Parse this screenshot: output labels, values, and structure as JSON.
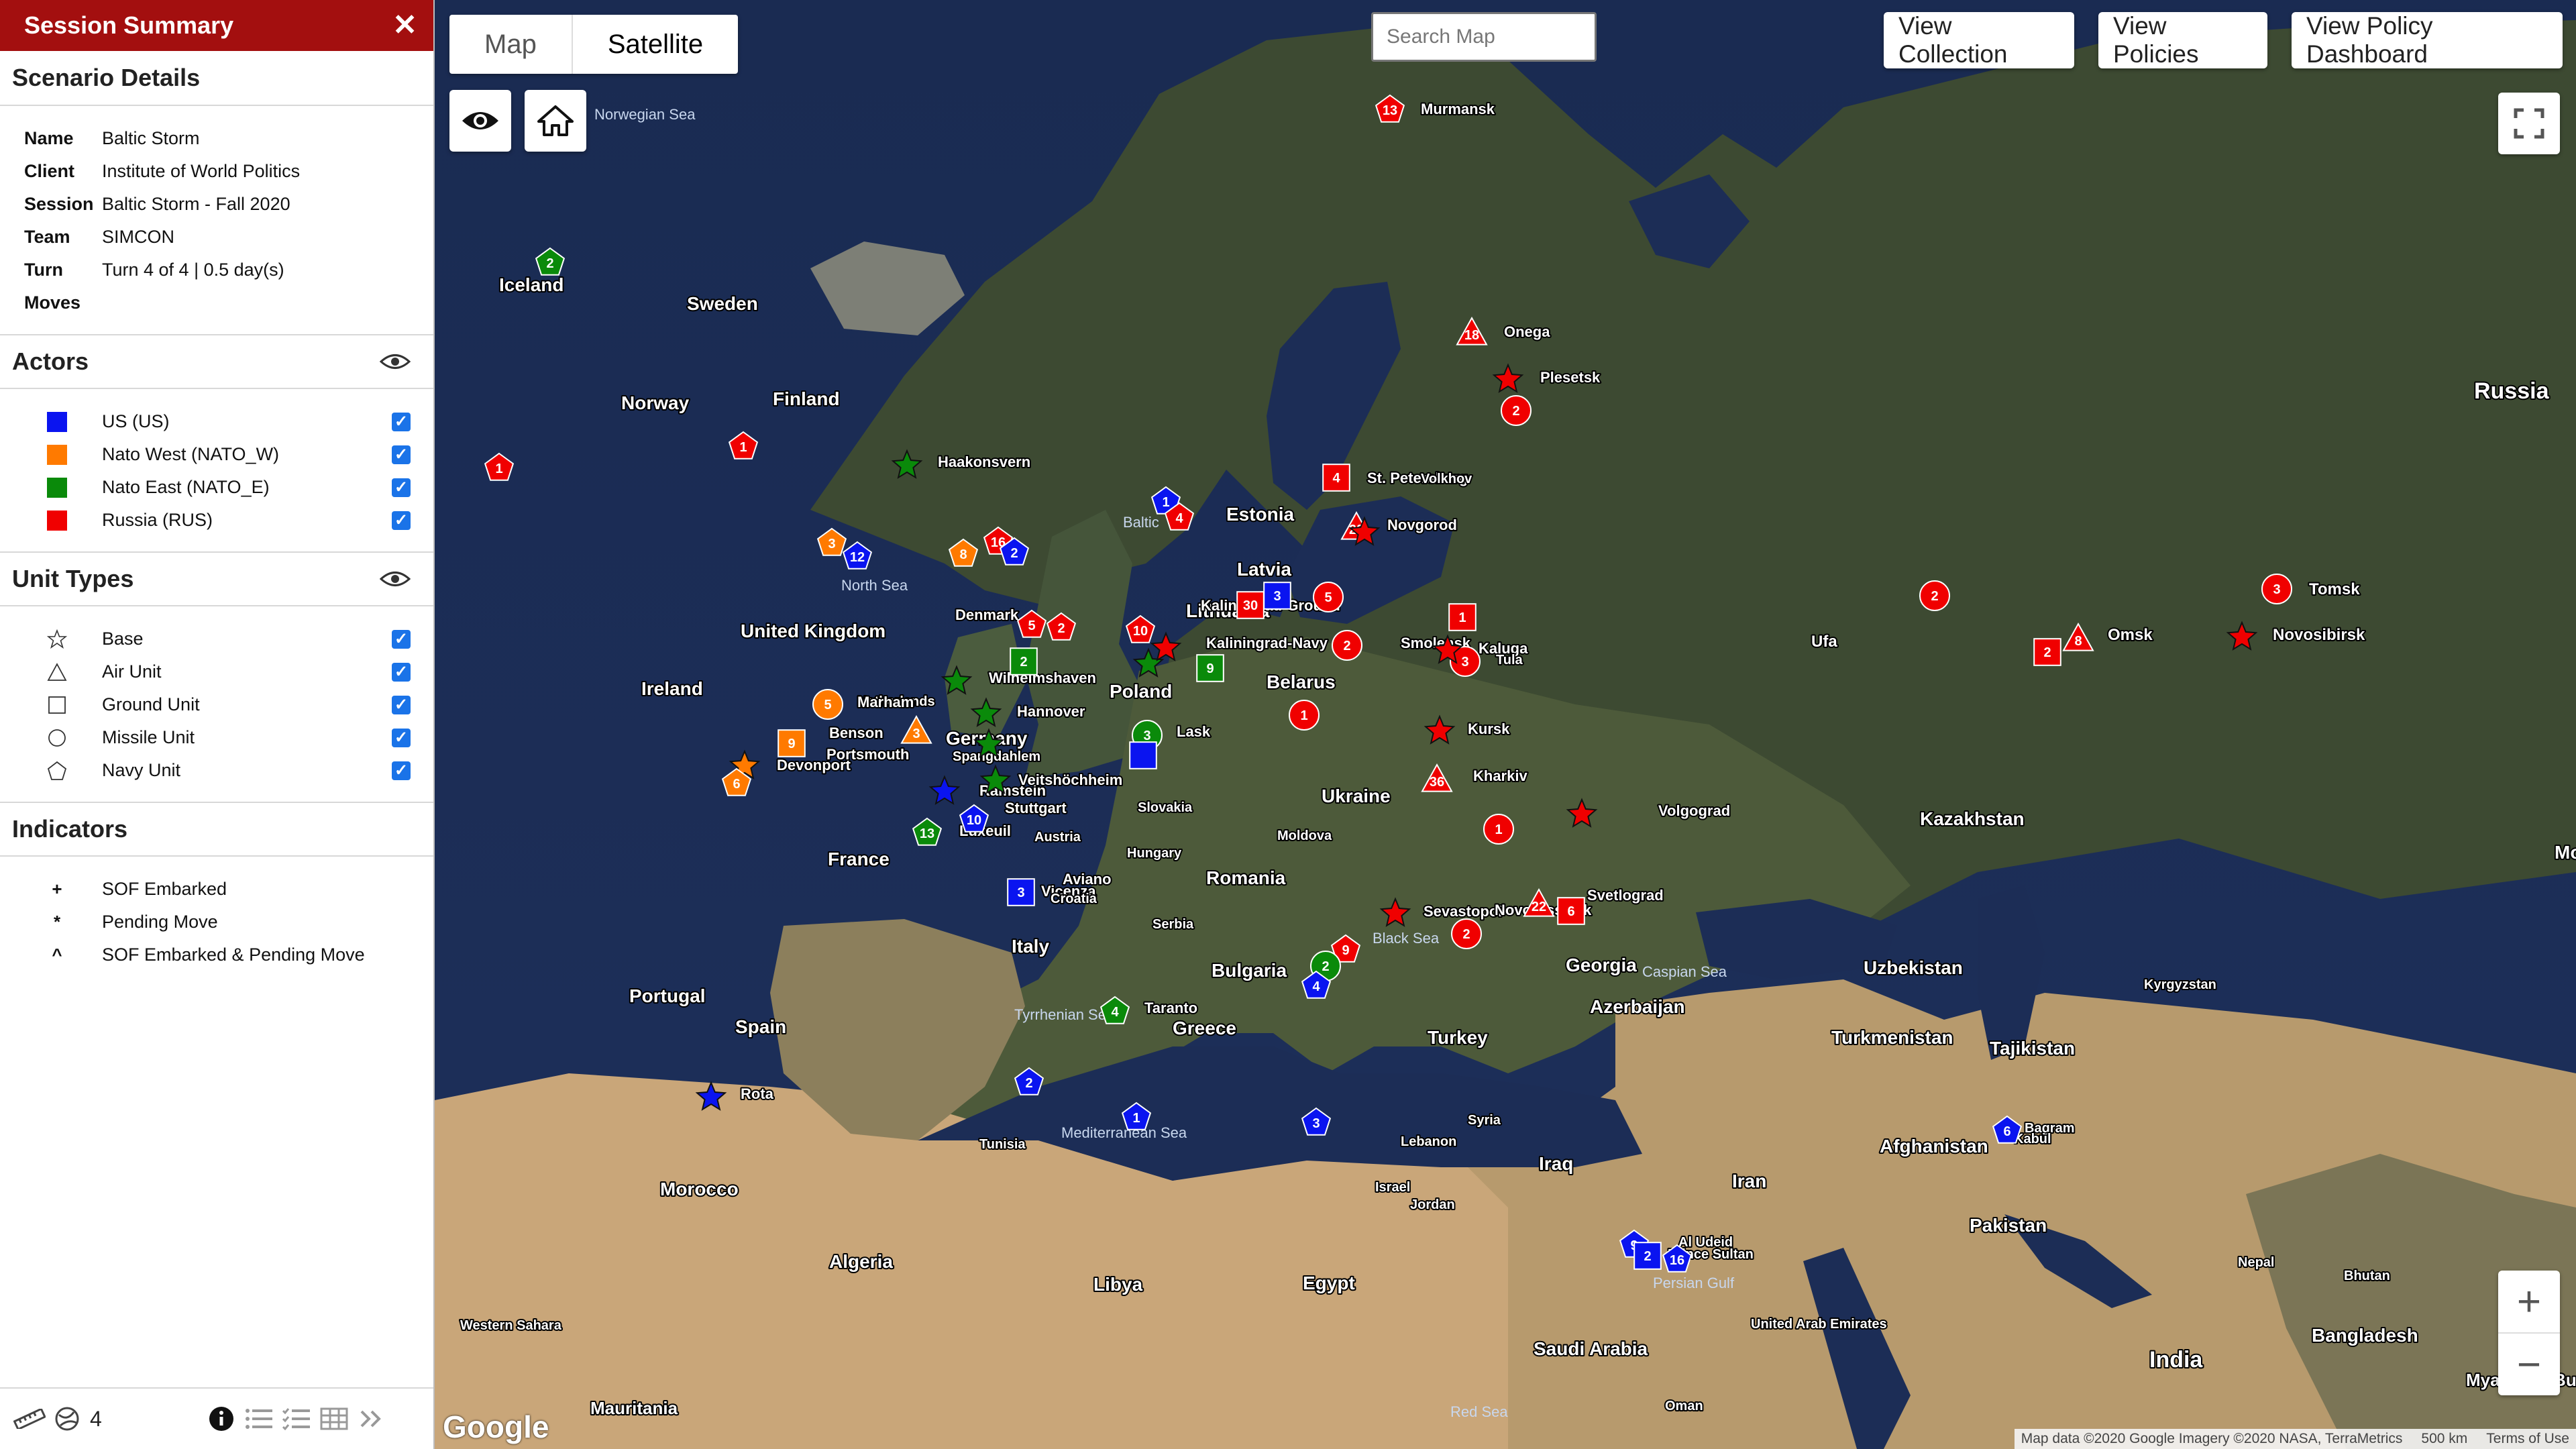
{
  "panel": {
    "title": "Session Summary",
    "close_label": "✕",
    "scenario": {
      "heading": "Scenario Details",
      "rows": [
        {
          "key": "Name",
          "value": "Baltic Storm"
        },
        {
          "key": "Client",
          "value": "Institute of World Politics"
        },
        {
          "key": "Session",
          "value": "Baltic Storm - Fall 2020"
        },
        {
          "key": "Team",
          "value": "SIMCON"
        },
        {
          "key": "Turn",
          "value": "Turn 4 of 4 | 0.5 day(s)"
        },
        {
          "key": "Moves",
          "value": ""
        }
      ]
    },
    "actors": {
      "heading": "Actors",
      "items": [
        {
          "label": "US (US)",
          "color": "#0a14f0",
          "checked": true
        },
        {
          "label": "Nato West (NATO_W)",
          "color": "#ff7a00",
          "checked": true
        },
        {
          "label": "Nato East (NATO_E)",
          "color": "#0a8a0a",
          "checked": true
        },
        {
          "label": "Russia (RUS)",
          "color": "#f00000",
          "checked": true
        }
      ]
    },
    "unit_types": {
      "heading": "Unit Types",
      "items": [
        {
          "label": "Base",
          "icon": "star-icon",
          "checked": true
        },
        {
          "label": "Air Unit",
          "icon": "triangle-icon",
          "checked": true
        },
        {
          "label": "Ground Unit",
          "icon": "square-icon",
          "checked": true
        },
        {
          "label": "Missile Unit",
          "icon": "circle-icon",
          "checked": true
        },
        {
          "label": "Navy Unit",
          "icon": "pentagon-icon",
          "checked": true
        }
      ]
    },
    "indicators": {
      "heading": "Indicators",
      "items": [
        {
          "symbol": "+",
          "label": "SOF Embarked"
        },
        {
          "symbol": "*",
          "label": "Pending Move"
        },
        {
          "symbol": "^",
          "label": "SOF Embarked & Pending Move"
        }
      ]
    },
    "footer": {
      "count": "4"
    }
  },
  "map": {
    "map_types": [
      "Map",
      "Satellite"
    ],
    "selected_map_type": "Satellite",
    "search_placeholder": "Search Map",
    "buttons": {
      "collection": "View Collection",
      "policies": "View Policies",
      "dashboard": "View Policy Dashboard"
    },
    "zoom_in": "+",
    "zoom_out": "−",
    "logo": "Google",
    "attribution": "Map data ©2020 Google Imagery ©2020 NASA, TerraMetrics",
    "scale": "500 km",
    "terms": "Terms of Use",
    "places": [
      "Iceland",
      "Norwegian Sea",
      "Sweden",
      "Finland",
      "Norway",
      "Russia",
      "Murmansk",
      "Onega",
      "Plesetsk",
      "Haakonsvern",
      "Estonia",
      "Latvia",
      "Lithuania",
      "Baltic",
      "North Sea",
      "Denmark",
      "United Kingdom",
      "Ireland",
      "Netherlands",
      "Wilhelmshaven",
      "Hannover",
      "Germany",
      "Poland",
      "Belarus",
      "Lask",
      "Benson",
      "Ramstein",
      "Stuttgart",
      "Spangdahlem",
      "Veitshöchheim",
      "Kaliningrad-Navy",
      "Kaliningrad-Ground",
      "St. Petersburg",
      "Volkhov",
      "Novgorod",
      "Smolensk",
      "Kaluga",
      "Tula",
      "Kursk",
      "Kharkiv",
      "Ukraine",
      "Volgograd",
      "Kazakhstan",
      "Ufa",
      "Omsk",
      "Tomsk",
      "Novosibirsk",
      "France",
      "Luxeuil",
      "Austria",
      "Hungary",
      "Slovakia",
      "Moldova",
      "Romania",
      "Aviano",
      "Vicenza",
      "Croatia",
      "Serbia",
      "Bulgaria",
      "Italy",
      "Spain",
      "Portugal",
      "Rota",
      "Morocco",
      "Tunisia",
      "Algeria",
      "Libya",
      "Egypt",
      "Tyrrhenian Sea",
      "Taranto",
      "Greece",
      "Turkey",
      "Black Sea",
      "Sevastopol",
      "Novorossiysk",
      "Svetlograd",
      "Georgia",
      "Azerbaijan",
      "Caspian Sea",
      "Mediterranean Sea",
      "Lebanon",
      "Syria",
      "Israel",
      "Jordan",
      "Iraq",
      "Iran",
      "Turkmenistan",
      "Uzbekistan",
      "Kyrgyzstan",
      "Tajikistan",
      "Afghanistan",
      "Bagram",
      "Kabul",
      "Pakistan",
      "India",
      "Nepal",
      "Bhutan",
      "Bangladesh",
      "Myanmar (Burma)",
      "Saudi Arabia",
      "United Arab Emirates",
      "Oman",
      "Al Udeid",
      "Prince Sultan",
      "Persian Gulf",
      "Western Sahara",
      "Mauritania",
      "Red Sea",
      "Devonport",
      "Portsmouth",
      "Marham",
      "Mo"
    ],
    "units": [
      {
        "actor": "RUS",
        "type": "navy",
        "n": "13",
        "place": "Murmansk"
      },
      {
        "actor": "RUS",
        "type": "air",
        "n": "18",
        "place": "Onega"
      },
      {
        "actor": "RUS",
        "type": "missile",
        "n": "2",
        "place": "Plesetsk"
      },
      {
        "actor": "RUS",
        "type": "base",
        "n": "",
        "place": "Plesetsk"
      },
      {
        "actor": "NATO_E",
        "type": "navy",
        "n": "2",
        "place": "Norwegian Sea"
      },
      {
        "actor": "RUS",
        "type": "navy",
        "n": "1",
        "place": "Norwegian Sea"
      },
      {
        "actor": "RUS",
        "type": "navy",
        "n": "1",
        "place": "Norway"
      },
      {
        "actor": "NATO_E",
        "type": "base",
        "n": "",
        "place": "Haakonsvern"
      },
      {
        "actor": "US",
        "type": "navy",
        "n": "1",
        "place": "Baltic"
      },
      {
        "actor": "RUS",
        "type": "navy",
        "n": "4",
        "place": "Baltic"
      },
      {
        "actor": "NATO_W",
        "type": "navy",
        "n": "3",
        "place": "North Sea"
      },
      {
        "actor": "US",
        "type": "navy",
        "n": "12",
        "place": "North Sea"
      },
      {
        "actor": "NATO_W",
        "type": "navy",
        "n": "8",
        "place": "Denmark"
      },
      {
        "actor": "RUS",
        "type": "navy",
        "n": "16",
        "place": "Denmark"
      },
      {
        "actor": "US",
        "type": "navy",
        "n": "2",
        "place": "Denmark"
      },
      {
        "actor": "RUS",
        "type": "navy",
        "n": "5",
        "place": "Denmark"
      },
      {
        "actor": "RUS",
        "type": "navy",
        "n": "2",
        "place": "Denmark"
      },
      {
        "actor": "NATO_E",
        "type": "ground",
        "n": "2",
        "place": "Wilhelmshaven"
      },
      {
        "actor": "RUS",
        "type": "navy",
        "n": "10",
        "place": "Kaliningrad-Navy"
      },
      {
        "actor": "NATO_E",
        "type": "base",
        "n": "",
        "place": "Kaliningrad-Navy"
      },
      {
        "actor": "RUS",
        "type": "base",
        "n": "",
        "place": "Kaliningrad-Ground"
      },
      {
        "actor": "NATO_E",
        "type": "ground",
        "n": "9",
        "place": "Lithuania"
      },
      {
        "actor": "US",
        "type": "ground",
        "n": "3",
        "place": "Latvia"
      },
      {
        "actor": "RUS",
        "type": "ground",
        "n": "30",
        "place": "Kaliningrad-Ground"
      },
      {
        "actor": "RUS",
        "type": "missile",
        "n": "5",
        "place": "Latvia"
      },
      {
        "actor": "RUS",
        "type": "ground",
        "n": "4",
        "place": "St. Petersburg"
      },
      {
        "actor": "RUS",
        "type": "air",
        "n": "28",
        "place": "Novgorod"
      },
      {
        "actor": "RUS",
        "type": "base",
        "n": "",
        "place": "Volkhov"
      },
      {
        "actor": "RUS",
        "type": "ground",
        "n": "1",
        "place": "Smolensk"
      },
      {
        "actor": "RUS",
        "type": "missile",
        "n": "3",
        "place": "Tula"
      },
      {
        "actor": "RUS",
        "type": "base",
        "n": "",
        "place": "Smolensk"
      },
      {
        "actor": "RUS",
        "type": "missile",
        "n": "1",
        "place": "Belarus"
      },
      {
        "actor": "RUS",
        "type": "base",
        "n": "",
        "place": "Kursk"
      },
      {
        "actor": "RUS",
        "type": "air",
        "n": "36",
        "place": "Kharkiv"
      },
      {
        "actor": "RUS",
        "type": "missile",
        "n": "1",
        "place": "Ukraine"
      },
      {
        "actor": "RUS",
        "type": "base",
        "n": "",
        "place": "Volgograd"
      },
      {
        "actor": "RUS",
        "type": "missile",
        "n": "2",
        "place": "Ufa"
      },
      {
        "actor": "RUS",
        "type": "missile",
        "n": "2",
        "place": "Kazakhstan"
      },
      {
        "actor": "RUS",
        "type": "ground",
        "n": "2",
        "place": "Omsk"
      },
      {
        "actor": "RUS",
        "type": "air",
        "n": "8",
        "place": "Omsk"
      },
      {
        "actor": "RUS",
        "type": "missile",
        "n": "3",
        "place": "Tomsk"
      },
      {
        "actor": "RUS",
        "type": "base",
        "n": "",
        "place": "Novosibirsk"
      },
      {
        "actor": "NATO_W",
        "type": "missile",
        "n": "5",
        "place": "Marham"
      },
      {
        "actor": "NATO_W",
        "type": "ground",
        "n": "9",
        "place": "Benson"
      },
      {
        "actor": "NATO_W",
        "type": "air",
        "n": "3",
        "place": "Netherlands"
      },
      {
        "actor": "NATO_W",
        "type": "base",
        "n": "",
        "place": "Devonport"
      },
      {
        "actor": "NATO_W",
        "type": "navy",
        "n": "6",
        "place": "Devonport"
      },
      {
        "actor": "NATO_E",
        "type": "base",
        "n": "",
        "place": "Wilhelmshaven"
      },
      {
        "actor": "NATO_E",
        "type": "base",
        "n": "",
        "place": "Hannover"
      },
      {
        "actor": "NATO_E",
        "type": "missile",
        "n": "3",
        "place": "Poland"
      },
      {
        "actor": "US",
        "type": "ground",
        "n": "",
        "place": "Poland"
      },
      {
        "actor": "NATO_E",
        "type": "base",
        "n": "",
        "place": "Germany"
      },
      {
        "actor": "NATO_E",
        "type": "base",
        "n": "",
        "place": "Veitshöchheim"
      },
      {
        "actor": "US",
        "type": "base",
        "n": "",
        "place": "Ramstein"
      },
      {
        "actor": "US",
        "type": "navy",
        "n": "10",
        "place": "Stuttgart"
      },
      {
        "actor": "NATO_E",
        "type": "navy",
        "n": "13",
        "place": "Luxeuil"
      },
      {
        "actor": "US",
        "type": "ground",
        "n": "3",
        "place": "Aviano"
      },
      {
        "actor": "RUS",
        "type": "base",
        "n": "",
        "place": "Sevastopol"
      },
      {
        "actor": "RUS",
        "type": "navy",
        "n": "9",
        "place": "Black Sea"
      },
      {
        "actor": "NATO_E",
        "type": "missile",
        "n": "2",
        "place": "Black Sea"
      },
      {
        "actor": "US",
        "type": "navy",
        "n": "4",
        "place": "Bulgaria"
      },
      {
        "actor": "RUS",
        "type": "missile",
        "n": "2",
        "place": "Black Sea"
      },
      {
        "actor": "RUS",
        "type": "air",
        "n": "22",
        "place": "Novorossiysk"
      },
      {
        "actor": "RUS",
        "type": "ground",
        "n": "6",
        "place": "Novorossiysk"
      },
      {
        "actor": "NATO_E",
        "type": "navy",
        "n": "4",
        "place": "Taranto"
      },
      {
        "actor": "US",
        "type": "navy",
        "n": "2",
        "place": "Tyrrhenian Sea"
      },
      {
        "actor": "US",
        "type": "base",
        "n": "",
        "place": "Rota"
      },
      {
        "actor": "US",
        "type": "navy",
        "n": "1",
        "place": "Mediterranean Sea"
      },
      {
        "actor": "US",
        "type": "navy",
        "n": "3",
        "place": "Lebanon"
      },
      {
        "actor": "US",
        "type": "navy",
        "n": "6",
        "place": "Bagram"
      },
      {
        "actor": "US",
        "type": "navy",
        "n": "9",
        "place": "Persian Gulf"
      },
      {
        "actor": "US",
        "type": "ground",
        "n": "2",
        "place": "Persian Gulf"
      },
      {
        "actor": "US",
        "type": "navy",
        "n": "16",
        "place": "Persian Gulf"
      }
    ]
  }
}
